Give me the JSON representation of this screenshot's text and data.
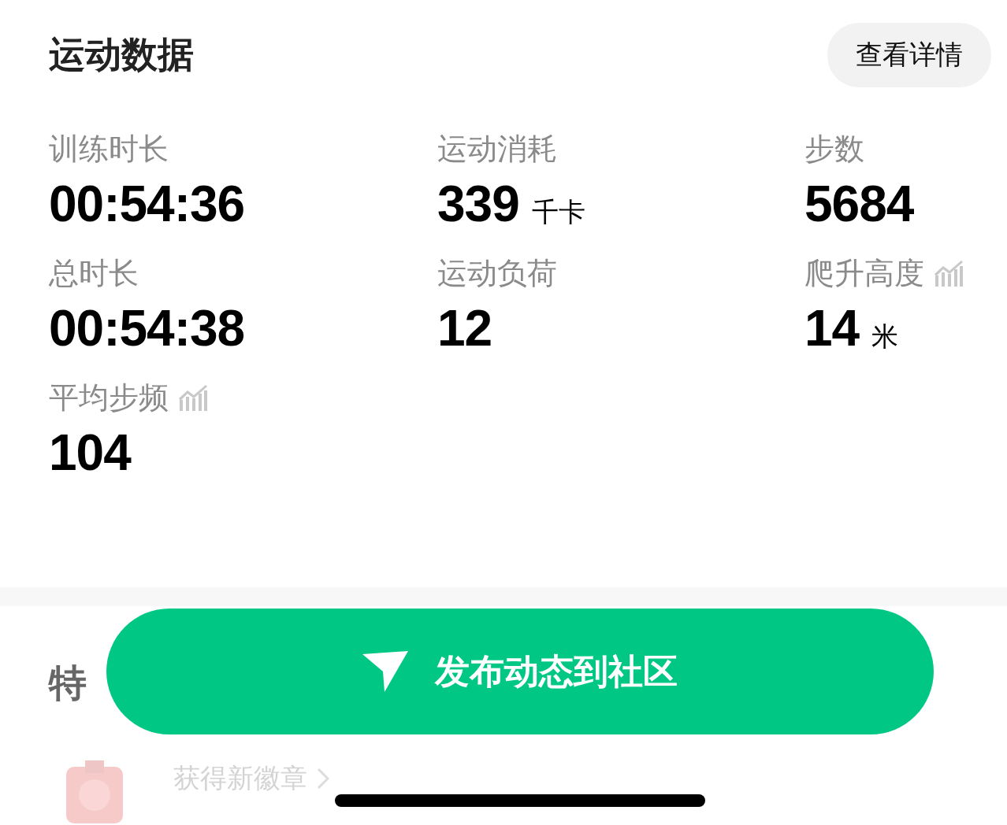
{
  "section": {
    "title": "运动数据",
    "details_button": "查看详情"
  },
  "metrics": [
    {
      "label": "训练时长",
      "value": "00:54:36",
      "trend_icon": false
    },
    {
      "label": "运动消耗",
      "value": "339",
      "unit": "千卡",
      "trend_icon": false
    },
    {
      "label": "步数",
      "value": "5684",
      "trend_icon": false
    },
    {
      "label": "总时长",
      "value": "00:54:38",
      "trend_icon": false
    },
    {
      "label": "运动负荷",
      "value": "12",
      "trend_icon": false
    },
    {
      "label": "爬升高度",
      "value": "14",
      "unit": "米",
      "trend_icon": true
    },
    {
      "label": "平均步频",
      "value": "104",
      "trend_icon": true
    }
  ],
  "next_section": {
    "title": "特"
  },
  "badge_item": {
    "text": "获得新徽章"
  },
  "publish_button": {
    "label": "发布动态到社区"
  }
}
